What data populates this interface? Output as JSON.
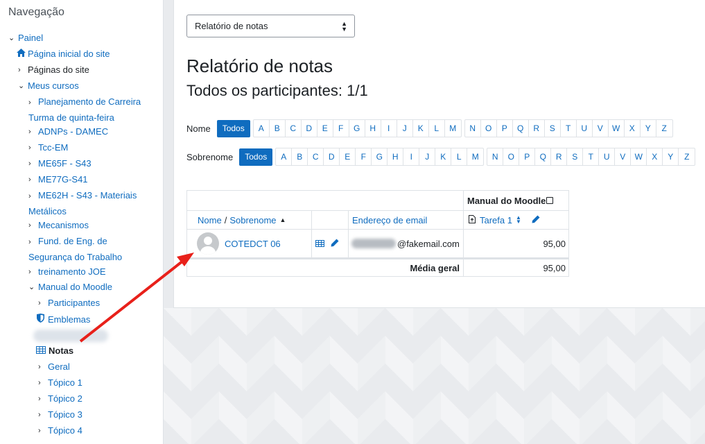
{
  "nav": {
    "title": "Navegação",
    "painel": "Painel",
    "home": "Página inicial do site",
    "site_pages": "Páginas do site",
    "my_courses": "Meus cursos",
    "courses": [
      "Planejamento de Carreira Turma de quinta-feira",
      "ADNPs - DAMEC",
      "Tcc-EM",
      "ME65F - S43",
      "ME77G-S41",
      "ME62H - S43 - Materiais Metálicos",
      "Mecanismos",
      "Fund. de Eng. de Segurança do Trabalho",
      "treinamento JOE",
      "Manual do Moodle"
    ],
    "sub": {
      "participants": "Participantes",
      "badges": "Emblemas",
      "grades": "Notas",
      "general": "Geral",
      "topic1": "Tópico 1",
      "topic2": "Tópico 2",
      "topic3": "Tópico 3",
      "topic4": "Tópico 4"
    }
  },
  "report_select": {
    "value": "Relatório de notas"
  },
  "heading": "Relatório de notas",
  "subheading": "Todos os participantes: 1/1",
  "filters": {
    "first_label": "Nome",
    "last_label": "Sobrenome",
    "all": "Todos",
    "letters_a": [
      "A",
      "B",
      "C",
      "D",
      "E",
      "F",
      "G",
      "H",
      "I",
      "J",
      "K",
      "L",
      "M"
    ],
    "letters_b": [
      "N",
      "O",
      "P",
      "Q",
      "R",
      "S",
      "T",
      "U",
      "V",
      "W",
      "X",
      "Y",
      "Z"
    ]
  },
  "table": {
    "course_header": "Manual do Moodle",
    "col_name": "Nome",
    "col_sep": "/",
    "col_surname": "Sobrenome",
    "col_email": "Endereço de email",
    "col_task": "Tarefa 1",
    "row": {
      "name": "COTEDCT 06",
      "email_suffix": "@fakemail.com",
      "grade": "95,00"
    },
    "avg_label": "Média geral",
    "avg_value": "95,00"
  },
  "colors": {
    "link": "#0f6cbf",
    "arrow": "#e8201a"
  }
}
